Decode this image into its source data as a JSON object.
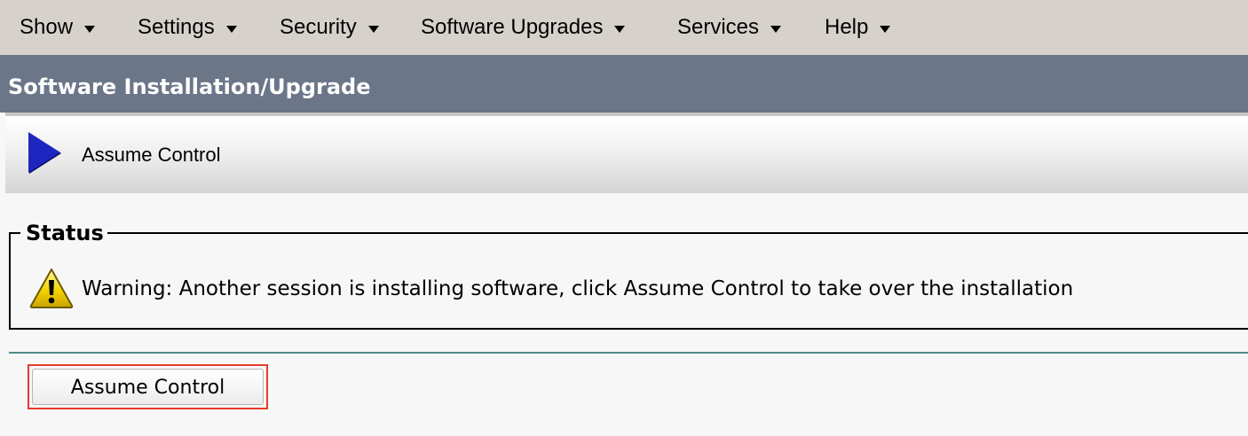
{
  "menu": {
    "items": [
      {
        "label": "Show"
      },
      {
        "label": "Settings"
      },
      {
        "label": "Security"
      },
      {
        "label": "Software Upgrades"
      },
      {
        "label": "Services"
      },
      {
        "label": "Help"
      }
    ]
  },
  "page": {
    "title": "Software Installation/Upgrade"
  },
  "toolbar": {
    "action_label": "Assume Control",
    "action_icon": "play-arrow-icon"
  },
  "status": {
    "legend": "Status",
    "icon": "warning-icon",
    "message": "Warning: Another session is installing software, click Assume Control to take over the installation"
  },
  "actions": {
    "assume_control_label": "Assume Control"
  },
  "colors": {
    "menubar_bg": "#d6d2cb",
    "titlebar_bg": "#6b7689",
    "play_icon": "#1e26c0",
    "divider": "#4e8a86",
    "highlight_border": "#e53b2a",
    "warning_yellow": "#f3d400"
  }
}
